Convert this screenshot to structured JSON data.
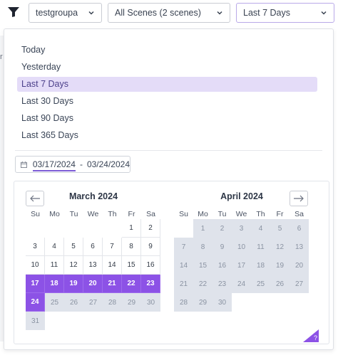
{
  "toolbar": {
    "group_select": "testgroupa",
    "scenes_select": "All Scenes (2 scenes)",
    "range_select": "Last 7 Days"
  },
  "left_edge_mark": "r",
  "presets": [
    "Today",
    "Yesterday",
    "Last 7 Days",
    "Last 30 Days",
    "Last 90 Days",
    "Last 365 Days"
  ],
  "selected_preset": "Last 7 Days",
  "date_range": {
    "start": "03/17/2024",
    "separator": "-",
    "end": "03/24/2024"
  },
  "calendar": {
    "weekdays": [
      "Su",
      "Mo",
      "Tu",
      "We",
      "Th",
      "Fr",
      "Sa"
    ],
    "left": {
      "title": "March 2024",
      "first_weekday": 5,
      "days": 31,
      "range_start": 17,
      "range_end": 24
    },
    "right": {
      "title": "April 2024",
      "first_weekday": 1,
      "days": 30
    }
  },
  "help_label": "?",
  "colors": {
    "accent": "#8c52e6",
    "preset_highlight": "#e4dcf8",
    "out_of_range": "#dfe3eb"
  }
}
